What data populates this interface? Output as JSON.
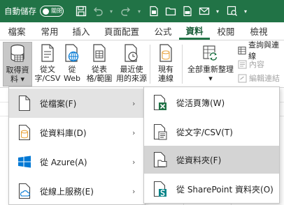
{
  "titlebar": {
    "autosave_label": "自動儲存",
    "toggle_text": "關閉",
    "icons": [
      "save-icon",
      "undo-icon",
      "redo-icon",
      "new-workbook-icon",
      "open-folder-icon",
      "export-pdf-icon",
      "email-icon",
      "customize-icon"
    ]
  },
  "tabs": [
    {
      "label": "檔案",
      "active": false
    },
    {
      "label": "常用",
      "active": false
    },
    {
      "label": "插入",
      "active": false
    },
    {
      "label": "頁面配置",
      "active": false
    },
    {
      "label": "公式",
      "active": false
    },
    {
      "label": "資料",
      "active": true
    },
    {
      "label": "校閱",
      "active": false
    },
    {
      "label": "檢視",
      "active": false
    }
  ],
  "ribbon": {
    "get_data": {
      "line1": "取得資",
      "line2": "料 ▾"
    },
    "from_text_csv": {
      "line1": "從文",
      "line2": "字/CSV"
    },
    "from_web": {
      "line1": "從",
      "line2": "Web"
    },
    "from_table": {
      "line1": "從表",
      "line2": "格/範圍"
    },
    "recent_sources": {
      "line1": "最近使",
      "line2": "用的來源"
    },
    "existing_connections": {
      "line1": "現有",
      "line2": "連線"
    },
    "refresh_all": {
      "line1": "全部重新整理",
      "line2": "▾"
    },
    "queries_connections": "查詢與連線",
    "properties": "內容",
    "edit_links": "編輯連結"
  },
  "menu": {
    "items": [
      {
        "label": "從檔案(F)",
        "icon": "file-icon",
        "hover": true
      },
      {
        "label": "從資料庫(D)",
        "icon": "database-icon",
        "hover": false
      },
      {
        "label": "從 Azure(A)",
        "icon": "azure-icon",
        "hover": false
      },
      {
        "label": "從線上服務(E)",
        "icon": "cloud-icon",
        "hover": false
      }
    ]
  },
  "submenu": {
    "items": [
      {
        "label": "從活頁簿(W)",
        "icon": "excel-workbook-icon",
        "hover": false
      },
      {
        "label": "從文字/CSV(T)",
        "icon": "text-csv-file-icon",
        "hover": false
      },
      {
        "label": "從資料夾(F)",
        "icon": "folder-file-icon",
        "hover": true
      },
      {
        "label": "從 SharePoint 資料夾(O)",
        "icon": "sharepoint-file-icon",
        "hover": false
      }
    ]
  },
  "colors": {
    "excel_green": "#217346",
    "sharepoint_teal": "#038387",
    "azure_blue": "#0078d4"
  }
}
